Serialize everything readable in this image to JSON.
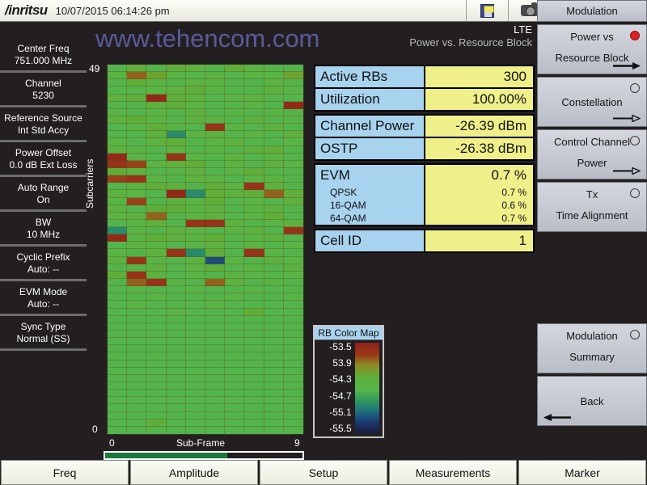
{
  "topbar": {
    "brand": "/inritsu",
    "datetime": "10/07/2015 06:14:26 pm",
    "icons": [
      "save-icon",
      "camera-icon",
      "battery-icon"
    ]
  },
  "watermark": "www.tehencom.com",
  "header": {
    "mode": "LTE",
    "measurement_title": "Power vs. Resource Block"
  },
  "sidebar": {
    "items": [
      {
        "label": "Center Freq",
        "value": "751.000 MHz"
      },
      {
        "label": "Channel",
        "value": "5230"
      },
      {
        "label": "Reference Source",
        "value": "Int Std Accy"
      },
      {
        "label": "Power Offset",
        "value": "0.0 dB Ext Loss"
      },
      {
        "label": "Auto Range",
        "value": "On"
      },
      {
        "label": "BW",
        "value": "10 MHz"
      },
      {
        "label": "Cyclic Prefix",
        "value": "Auto: --"
      },
      {
        "label": "EVM Mode",
        "value": "Auto: --"
      },
      {
        "label": "Sync Type",
        "value": "Normal (SS)"
      }
    ]
  },
  "results": {
    "groups": [
      {
        "rows": [
          {
            "label": "Active RBs",
            "value": "300"
          },
          {
            "label": "Utilization",
            "value": "100.00%"
          }
        ]
      },
      {
        "rows": [
          {
            "label": "Channel Power",
            "value": "-26.39 dBm"
          },
          {
            "label": "OSTP",
            "value": "-26.38 dBm"
          }
        ]
      },
      {
        "rows": [
          {
            "label": "EVM",
            "value": "0.7 %"
          },
          {
            "label": "QPSK",
            "value": "0.7 %",
            "sub": true
          },
          {
            "label": "16-QAM",
            "value": "0.6 %",
            "sub": true
          },
          {
            "label": "64-QAM",
            "value": "0.7 %",
            "sub": true
          }
        ]
      },
      {
        "rows": [
          {
            "label": "Cell ID",
            "value": "1"
          }
        ]
      }
    ]
  },
  "color_map": {
    "title": "RB Color Map",
    "ticks": [
      "-53.5",
      "53.9",
      "-54.3",
      "-54.7",
      "-55.1",
      "-55.5"
    ],
    "top_color": "#8e2119",
    "bottom_color": "#191a3d"
  },
  "function_keys": {
    "header": "Modulation",
    "items": [
      {
        "line1": "Power vs",
        "line2": "Resource Block",
        "selected": true,
        "arrow": "solid-right"
      },
      {
        "line1": "Constellation",
        "line2": "",
        "selected": false,
        "arrow": "hollow-right"
      },
      {
        "line1": "Control Channel",
        "line2": "Power",
        "selected": false,
        "arrow": "hollow-right"
      },
      {
        "line1": "Tx",
        "line2": "Time Alignment",
        "selected": false,
        "arrow": "none"
      },
      {
        "line1": "Modulation",
        "line2": "Summary",
        "selected": false,
        "arrow": "none"
      },
      {
        "line1": "Back",
        "line2": "",
        "selected": false,
        "arrow": "solid-left"
      }
    ]
  },
  "bottom_tabs": [
    "Freq",
    "Amplitude",
    "Setup",
    "Measurements",
    "Marker"
  ],
  "progress_percent": 62,
  "chart_data": {
    "type": "heatmap",
    "title": "Power vs. Resource Block",
    "xlabel": "Sub-Frame",
    "ylabel": "Subcarriers",
    "xlim": [
      0,
      9
    ],
    "ylim": [
      0,
      49
    ],
    "xticks": [
      "0",
      "9"
    ],
    "yticks": [
      "0",
      "49"
    ],
    "colorbar": {
      "label": "RB Color Map",
      "unit": "dBm",
      "max": -53.5,
      "min": -55.5,
      "ticks": [
        -53.5,
        -53.9,
        -54.3,
        -54.7,
        -55.1,
        -55.5
      ]
    },
    "columns": 10,
    "rows": 50,
    "note": "Values are power per resource block in dBm; rows 0-24 are uniform nominal green (~-54.6 dBm), rows 25-49 show scattered variation.",
    "values": [
      [
        -54.6,
        -54.3,
        -54.6,
        -54.3,
        -54.4,
        -54.6,
        -54.3,
        -54.5,
        -54.6,
        -54.6
      ],
      [
        -54.5,
        -53.9,
        -54.2,
        -54.5,
        -54.6,
        -54.4,
        -54.6,
        -54.5,
        -54.5,
        -54.2
      ],
      [
        -54.6,
        -54.3,
        -54.5,
        -54.6,
        -54.4,
        -54.5,
        -54.6,
        -54.6,
        -54.5,
        -54.6
      ],
      [
        -54.6,
        -54.6,
        -54.5,
        -54.4,
        -54.3,
        -54.5,
        -54.6,
        -54.6,
        -54.4,
        -54.5
      ],
      [
        -54.4,
        -54.3,
        -53.6,
        -54.3,
        -54.4,
        -54.6,
        -54.5,
        -54.4,
        -54.6,
        -54.6
      ],
      [
        -54.6,
        -54.6,
        -54.4,
        -54.3,
        -54.5,
        -54.6,
        -54.6,
        -54.5,
        -54.6,
        -53.6
      ],
      [
        -54.5,
        -54.6,
        -54.5,
        -54.6,
        -54.4,
        -54.6,
        -54.5,
        -54.6,
        -54.5,
        -54.6
      ],
      [
        -54.4,
        -54.3,
        -54.5,
        -54.6,
        -54.4,
        -54.5,
        -54.6,
        -54.4,
        -54.6,
        -54.5
      ],
      [
        -54.6,
        -54.5,
        -54.3,
        -54.5,
        -54.6,
        -53.7,
        -54.5,
        -54.6,
        -54.4,
        -54.6
      ],
      [
        -54.6,
        -54.6,
        -54.4,
        -54.9,
        -54.5,
        -54.4,
        -54.6,
        -54.5,
        -54.6,
        -54.4
      ],
      [
        -54.5,
        -54.6,
        -54.4,
        -54.3,
        -54.6,
        -54.5,
        -54.4,
        -54.6,
        -54.6,
        -54.5
      ],
      [
        -54.4,
        -54.5,
        -54.6,
        -54.4,
        -54.6,
        -54.5,
        -54.6,
        -54.4,
        -54.3,
        -54.6
      ],
      [
        -53.6,
        -54.5,
        -54.6,
        -53.7,
        -54.5,
        -54.6,
        -54.4,
        -54.6,
        -54.5,
        -54.6
      ],
      [
        -53.7,
        -53.8,
        -54.5,
        -54.4,
        -54.3,
        -54.6,
        -54.5,
        -54.6,
        -54.4,
        -54.5
      ],
      [
        -54.3,
        -54.4,
        -54.6,
        -54.5,
        -54.4,
        -54.6,
        -54.5,
        -54.3,
        -54.6,
        -54.6
      ],
      [
        -53.8,
        -53.7,
        -54.5,
        -54.6,
        -54.4,
        -54.5,
        -54.6,
        -54.5,
        -54.4,
        -54.6
      ],
      [
        -54.6,
        -54.5,
        -54.3,
        -54.4,
        -54.6,
        -54.3,
        -54.5,
        -53.7,
        -54.4,
        -54.6
      ],
      [
        -54.4,
        -54.5,
        -54.6,
        -53.6,
        -54.9,
        -54.3,
        -54.4,
        -54.3,
        -53.9,
        -54.3
      ],
      [
        -54.5,
        -53.8,
        -54.6,
        -54.4,
        -54.5,
        -54.3,
        -54.6,
        -54.5,
        -54.6,
        -54.4
      ],
      [
        -54.4,
        -54.6,
        -54.3,
        -54.3,
        -54.5,
        -54.4,
        -54.6,
        -54.5,
        -54.4,
        -54.6
      ],
      [
        -54.5,
        -54.4,
        -53.9,
        -54.6,
        -54.5,
        -54.4,
        -54.6,
        -54.5,
        -54.3,
        -54.6
      ],
      [
        -54.6,
        -54.5,
        -54.3,
        -54.6,
        -53.7,
        -53.7,
        -54.4,
        -54.6,
        -54.5,
        -54.4
      ],
      [
        -54.9,
        -54.5,
        -54.6,
        -54.4,
        -54.5,
        -54.6,
        -54.5,
        -54.4,
        -54.6,
        -53.7
      ],
      [
        -53.6,
        -54.5,
        -54.3,
        -54.4,
        -54.5,
        -54.3,
        -54.6,
        -54.5,
        -54.4,
        -54.6
      ],
      [
        -54.6,
        -54.4,
        -54.5,
        -54.6,
        -54.5,
        -54.4,
        -54.6,
        -54.5,
        -54.6,
        -54.5
      ],
      [
        -54.5,
        -54.6,
        -54.4,
        -53.7,
        -54.9,
        -54.3,
        -54.6,
        -53.7,
        -54.5,
        -54.6
      ],
      [
        -54.4,
        -53.7,
        -54.5,
        -54.6,
        -54.4,
        -55.2,
        -54.5,
        -54.6,
        -54.4,
        -54.5
      ],
      [
        -54.6,
        -54.5,
        -54.4,
        -54.6,
        -54.5,
        -54.3,
        -54.6,
        -54.5,
        -54.6,
        -54.4
      ],
      [
        -54.3,
        -53.7,
        -54.4,
        -54.6,
        -54.5,
        -54.6,
        -54.4,
        -54.5,
        -54.6,
        -54.5
      ],
      [
        -54.6,
        -53.9,
        -53.7,
        -54.5,
        -54.6,
        -53.9,
        -54.4,
        -54.6,
        -54.5,
        -54.6
      ],
      [
        -54.6,
        -54.5,
        -54.6,
        -54.6,
        -54.5,
        -54.6,
        -54.6,
        -54.5,
        -54.6,
        -54.6
      ],
      [
        -54.6,
        -54.6,
        -54.5,
        -54.6,
        -54.6,
        -54.6,
        -54.5,
        -54.6,
        -54.6,
        -54.5
      ],
      [
        -54.6,
        -54.5,
        -54.6,
        -54.6,
        -54.6,
        -54.5,
        -54.6,
        -54.6,
        -54.6,
        -54.6
      ],
      [
        -54.6,
        -54.6,
        -54.6,
        -54.5,
        -54.6,
        -54.6,
        -54.6,
        -54.3,
        -54.6,
        -54.6
      ],
      [
        -54.6,
        -54.6,
        -54.6,
        -54.6,
        -54.6,
        -54.6,
        -54.6,
        -54.6,
        -54.6,
        -54.6
      ],
      [
        -54.6,
        -54.6,
        -54.6,
        -54.6,
        -54.6,
        -54.6,
        -54.6,
        -54.6,
        -54.6,
        -54.6
      ],
      [
        -54.6,
        -54.6,
        -54.6,
        -54.6,
        -54.6,
        -54.6,
        -54.6,
        -54.6,
        -54.6,
        -54.6
      ],
      [
        -54.6,
        -54.6,
        -54.6,
        -54.6,
        -54.6,
        -54.6,
        -54.6,
        -54.6,
        -54.6,
        -54.6
      ],
      [
        -54.6,
        -54.6,
        -54.6,
        -54.6,
        -54.6,
        -54.6,
        -54.6,
        -54.6,
        -54.6,
        -54.6
      ],
      [
        -54.6,
        -54.6,
        -54.6,
        -54.6,
        -54.6,
        -54.6,
        -54.6,
        -54.6,
        -54.6,
        -54.6
      ],
      [
        -54.6,
        -54.6,
        -54.6,
        -54.6,
        -54.6,
        -54.6,
        -54.6,
        -54.6,
        -54.6,
        -54.6
      ],
      [
        -54.6,
        -54.6,
        -54.6,
        -54.6,
        -54.6,
        -54.6,
        -54.6,
        -54.6,
        -54.6,
        -54.6
      ],
      [
        -54.6,
        -54.6,
        -54.6,
        -54.6,
        -54.6,
        -54.6,
        -54.6,
        -54.6,
        -54.6,
        -54.6
      ],
      [
        -54.6,
        -54.6,
        -54.6,
        -54.6,
        -54.6,
        -54.6,
        -54.6,
        -54.6,
        -54.6,
        -54.6
      ],
      [
        -54.6,
        -54.6,
        -54.6,
        -54.6,
        -54.6,
        -54.6,
        -54.6,
        -54.6,
        -54.6,
        -54.6
      ],
      [
        -54.6,
        -54.6,
        -54.6,
        -54.6,
        -54.6,
        -54.6,
        -54.6,
        -54.6,
        -54.6,
        -54.6
      ],
      [
        -54.6,
        -54.6,
        -54.6,
        -54.6,
        -54.6,
        -54.6,
        -54.6,
        -54.6,
        -54.6,
        -54.6
      ],
      [
        -54.6,
        -54.6,
        -54.6,
        -54.6,
        -54.6,
        -54.6,
        -54.6,
        -54.6,
        -54.6,
        -54.6
      ],
      [
        -54.6,
        -54.6,
        -54.3,
        -54.6,
        -54.6,
        -54.6,
        -54.6,
        -54.6,
        -54.6,
        -54.6
      ],
      [
        -54.6,
        -54.6,
        -54.6,
        -54.6,
        -54.6,
        -54.6,
        -54.6,
        -54.6,
        -54.6,
        -54.6
      ]
    ]
  }
}
